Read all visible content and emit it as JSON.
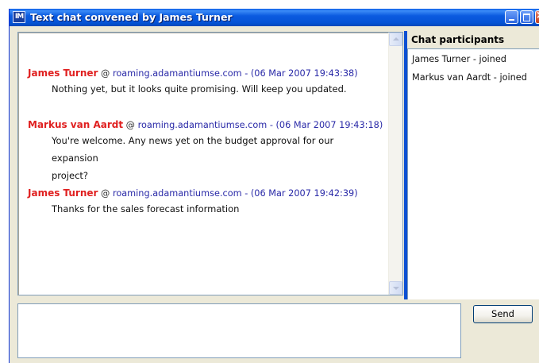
{
  "window": {
    "title": "Text chat convened by James Turner",
    "app_icon_text": "IM"
  },
  "messages": [
    {
      "sender": "James Turner",
      "at": " @ ",
      "host": "roaming.adamantiumse.com",
      "timestamp": " - (06 Mar 2007 19:43:38)",
      "lines": [
        "Nothing yet, but it looks quite promising. Will keep you updated."
      ]
    },
    {
      "sender": "Markus van Aardt",
      "at": " @ ",
      "host": "roaming.adamantiumse.com",
      "timestamp": " - (06 Mar 2007 19:43:18)",
      "lines": [
        "You're welcome. Any news yet on the budget approval for our expansion",
        "project?"
      ]
    },
    {
      "sender": "James Turner",
      "at": " @ ",
      "host": "roaming.adamantiumse.com",
      "timestamp": " - (06 Mar 2007 19:42:39)",
      "lines": [
        "Thanks for the sales forecast information"
      ]
    }
  ],
  "participants": {
    "heading": "Chat participants",
    "items": [
      "James Turner - joined",
      "Markus van Aardt - joined"
    ]
  },
  "input": {
    "value": "",
    "send_label": "Send"
  },
  "colors": {
    "sender": "#e02020",
    "host": "#2a2aa8",
    "titlebar": "#0553d6"
  },
  "icons": {
    "app": "im-app-icon",
    "minimize": "minimize-icon",
    "maximize": "maximize-icon",
    "close": "close-icon",
    "scroll_up": "scroll-up-arrow-icon",
    "scroll_down": "scroll-down-arrow-icon"
  }
}
